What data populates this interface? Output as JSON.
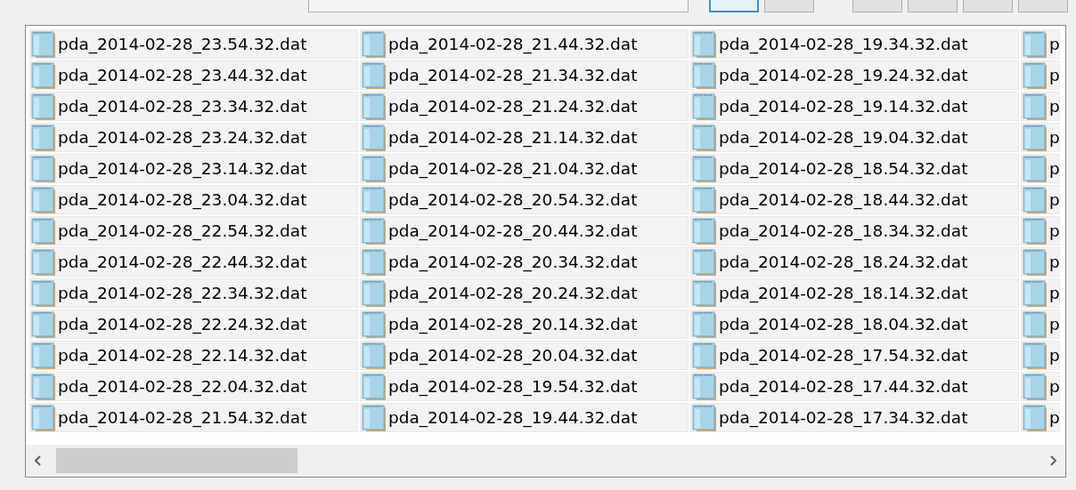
{
  "toolbar": {
    "field": {
      "kind": "field"
    },
    "buttons": [
      {
        "kind": "button",
        "selected": true
      },
      {
        "kind": "button",
        "selected": false
      },
      {
        "kind": "gap"
      },
      {
        "kind": "button",
        "selected": false
      },
      {
        "kind": "button",
        "selected": false
      },
      {
        "kind": "button",
        "selected": false
      },
      {
        "kind": "button",
        "selected": false
      }
    ]
  },
  "file_list": {
    "columns": [
      {
        "items": [
          "pda_2014-02-28_23.54.32.dat",
          "pda_2014-02-28_23.44.32.dat",
          "pda_2014-02-28_23.34.32.dat",
          "pda_2014-02-28_23.24.32.dat",
          "pda_2014-02-28_23.14.32.dat",
          "pda_2014-02-28_23.04.32.dat",
          "pda_2014-02-28_22.54.32.dat",
          "pda_2014-02-28_22.44.32.dat",
          "pda_2014-02-28_22.34.32.dat",
          "pda_2014-02-28_22.24.32.dat",
          "pda_2014-02-28_22.14.32.dat",
          "pda_2014-02-28_22.04.32.dat",
          "pda_2014-02-28_21.54.32.dat"
        ]
      },
      {
        "items": [
          "pda_2014-02-28_21.44.32.dat",
          "pda_2014-02-28_21.34.32.dat",
          "pda_2014-02-28_21.24.32.dat",
          "pda_2014-02-28_21.14.32.dat",
          "pda_2014-02-28_21.04.32.dat",
          "pda_2014-02-28_20.54.32.dat",
          "pda_2014-02-28_20.44.32.dat",
          "pda_2014-02-28_20.34.32.dat",
          "pda_2014-02-28_20.24.32.dat",
          "pda_2014-02-28_20.14.32.dat",
          "pda_2014-02-28_20.04.32.dat",
          "pda_2014-02-28_19.54.32.dat",
          "pda_2014-02-28_19.44.32.dat"
        ]
      },
      {
        "items": [
          "pda_2014-02-28_19.34.32.dat",
          "pda_2014-02-28_19.24.32.dat",
          "pda_2014-02-28_19.14.32.dat",
          "pda_2014-02-28_19.04.32.dat",
          "pda_2014-02-28_18.54.32.dat",
          "pda_2014-02-28_18.44.32.dat",
          "pda_2014-02-28_18.34.32.dat",
          "pda_2014-02-28_18.24.32.dat",
          "pda_2014-02-28_18.14.32.dat",
          "pda_2014-02-28_18.04.32.dat",
          "pda_2014-02-28_17.54.32.dat",
          "pda_2014-02-28_17.44.32.dat",
          "pda_2014-02-28_17.34.32.dat"
        ]
      },
      {
        "items": [
          "p",
          "p",
          "p",
          "p",
          "p",
          "p",
          "p",
          "p",
          "p",
          "p",
          "p",
          "p",
          "p"
        ]
      }
    ]
  }
}
